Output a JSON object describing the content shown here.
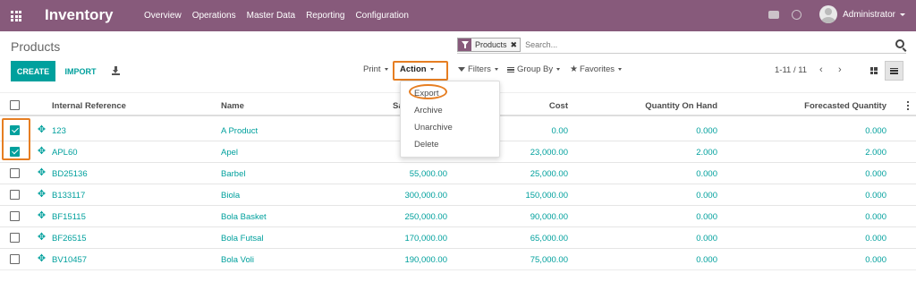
{
  "navbar": {
    "app_name": "Inventory",
    "menu": [
      "Overview",
      "Operations",
      "Master Data",
      "Reporting",
      "Configuration"
    ],
    "user": "Administrator",
    "color": "#875a7b"
  },
  "control_panel": {
    "breadcrumb": "Products",
    "search_facet": "Products",
    "search_placeholder": "Search...",
    "create_label": "CREATE",
    "import_label": "IMPORT",
    "print_label": "Print",
    "action_label": "Action",
    "filters_label": "Filters",
    "groupby_label": "Group By",
    "favorites_label": "Favorites",
    "pager": "1-11 / 11",
    "accent": "#00a09d",
    "highlight": "#e67e22"
  },
  "action_menu": [
    "Export",
    "Archive",
    "Unarchive",
    "Delete"
  ],
  "table": {
    "columns": [
      "Internal Reference",
      "Name",
      "Sa",
      "Cost",
      "Quantity On Hand",
      "Forecasted Quantity"
    ],
    "rows": [
      {
        "ref": "123",
        "name": "A Product",
        "sales": "",
        "cost": "0.00",
        "qty": "0.000",
        "forecast": "0.000",
        "checked": true
      },
      {
        "ref": "APL60",
        "name": "Apel",
        "sales": "",
        "cost": "23,000.00",
        "qty": "2.000",
        "forecast": "2.000",
        "checked": true
      },
      {
        "ref": "BD25136",
        "name": "Barbel",
        "sales": "55,000.00",
        "cost": "25,000.00",
        "qty": "0.000",
        "forecast": "0.000",
        "checked": false
      },
      {
        "ref": "B133117",
        "name": "Biola",
        "sales": "300,000.00",
        "cost": "150,000.00",
        "qty": "0.000",
        "forecast": "0.000",
        "checked": false
      },
      {
        "ref": "BF15115",
        "name": "Bola Basket",
        "sales": "250,000.00",
        "cost": "90,000.00",
        "qty": "0.000",
        "forecast": "0.000",
        "checked": false
      },
      {
        "ref": "BF26515",
        "name": "Bola Futsal",
        "sales": "170,000.00",
        "cost": "65,000.00",
        "qty": "0.000",
        "forecast": "0.000",
        "checked": false
      },
      {
        "ref": "BV10457",
        "name": "Bola Voli",
        "sales": "190,000.00",
        "cost": "75,000.00",
        "qty": "0.000",
        "forecast": "0.000",
        "checked": false
      }
    ]
  }
}
